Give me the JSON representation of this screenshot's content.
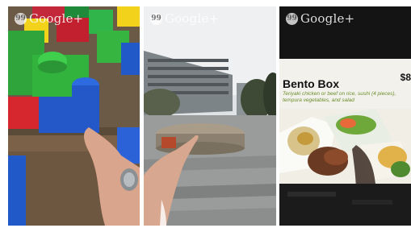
{
  "watermark": {
    "label": "Google+",
    "icon": "hangouts-bubble-icon",
    "glyph": "99"
  },
  "panels": [
    {
      "name": "toy-blocks-video",
      "scene": "building-blocks"
    },
    {
      "name": "campus-video",
      "scene": "plaza"
    },
    {
      "name": "menu-video",
      "scene": "menu-card"
    }
  ],
  "menu": {
    "title": "Bento Box",
    "price": "$8",
    "description": "Teriyaki chicken or beef on rice, sushi (4 pieces), tempura vegetables, and salad"
  },
  "colors": {
    "menu_text_green": "#6a8f2c",
    "watermark": "#ffffff"
  }
}
